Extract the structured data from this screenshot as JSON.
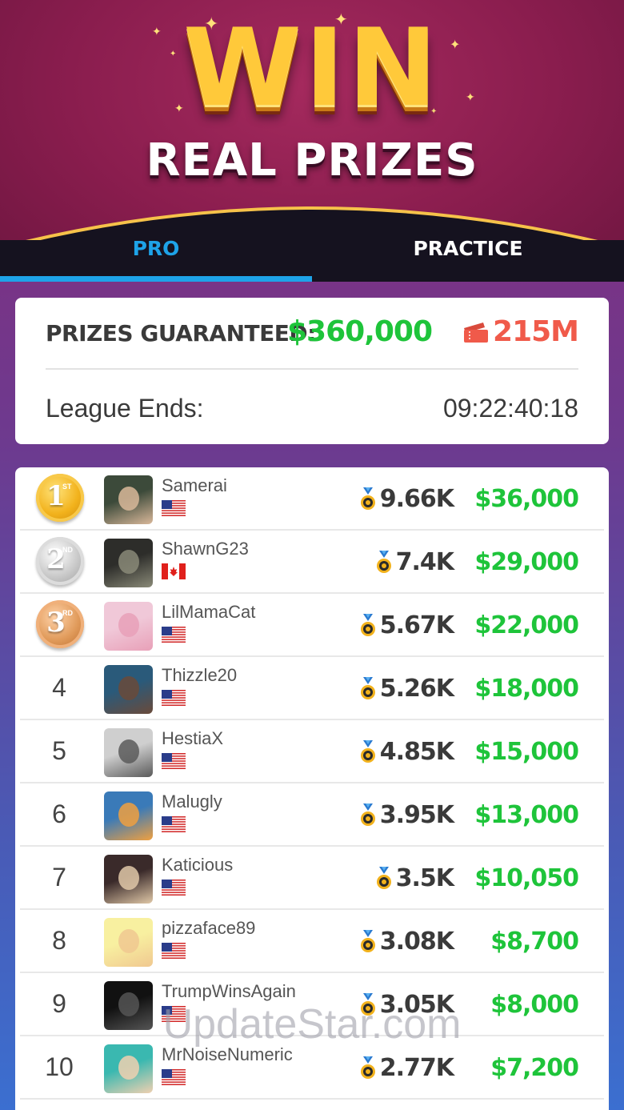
{
  "header": {
    "title": "WIN",
    "subtitle": "REAL PRIZES"
  },
  "tabs": [
    {
      "label": "PRO",
      "active": true
    },
    {
      "label": "PRACTICE",
      "active": false
    }
  ],
  "summary": {
    "guaranteed_label": "PRIZES GUARANTEED:",
    "guaranteed_amount": "$360,000",
    "ticket_count": "215M",
    "ticket_icon": "ticket-icon",
    "league_label": "League Ends:",
    "league_timer": "09:22:40:18"
  },
  "colors": {
    "accent_blue": "#1ea3e8",
    "prize_green": "#1ec43a",
    "ticket_red": "#f05a4a"
  },
  "leaderboard": [
    {
      "rank": "1",
      "suffix": "ST",
      "medal": "gold",
      "username": "Samerai",
      "flag": "us",
      "score": "9.66K",
      "prize": "$36,000"
    },
    {
      "rank": "2",
      "suffix": "ND",
      "medal": "silver",
      "username": "ShawnG23",
      "flag": "ca",
      "score": "7.4K",
      "prize": "$29,000"
    },
    {
      "rank": "3",
      "suffix": "RD",
      "medal": "bronze",
      "username": "LilMamaCat",
      "flag": "us",
      "score": "5.67K",
      "prize": "$22,000"
    },
    {
      "rank": "4",
      "username": "Thizzle20",
      "flag": "us",
      "score": "5.26K",
      "prize": "$18,000"
    },
    {
      "rank": "5",
      "username": "HestiaX",
      "flag": "us",
      "score": "4.85K",
      "prize": "$15,000"
    },
    {
      "rank": "6",
      "username": "Malugly",
      "flag": "us",
      "score": "3.95K",
      "prize": "$13,000"
    },
    {
      "rank": "7",
      "username": "Katicious",
      "flag": "us",
      "score": "3.5K",
      "prize": "$10,050"
    },
    {
      "rank": "8",
      "username": "pizzaface89",
      "flag": "us",
      "score": "3.08K",
      "prize": "$8,700"
    },
    {
      "rank": "9",
      "username": "TrumpWinsAgain",
      "flag": "us",
      "score": "3.05K",
      "prize": "$8,000"
    },
    {
      "rank": "10",
      "username": "MrNoiseNumeric",
      "flag": "us",
      "score": "2.77K",
      "prize": "$7,200"
    }
  ],
  "watermark": "UpdateStar.com"
}
